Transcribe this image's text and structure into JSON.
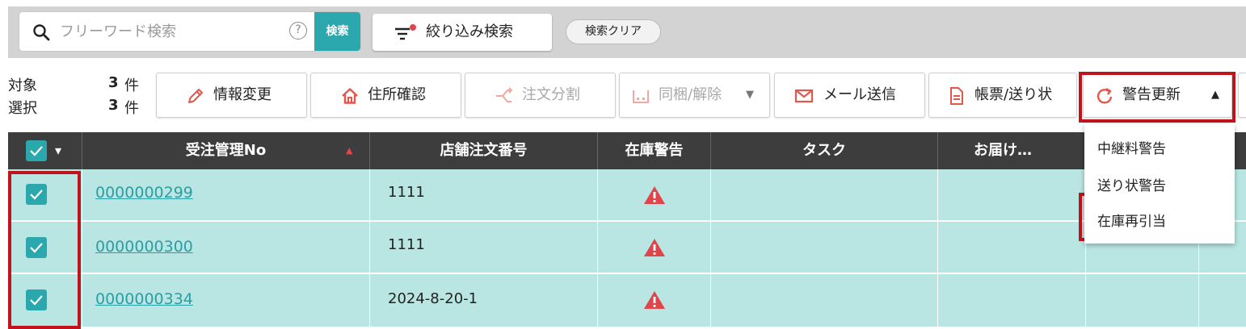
{
  "search": {
    "placeholder": "フリーワード検索",
    "help_label": "?",
    "button_label": "検索",
    "filter_label": "絞り込み検索",
    "clear_label": "検索クリア"
  },
  "counts": {
    "target_label": "対象",
    "target_value": "3",
    "selected_label": "選択",
    "selected_value": "3",
    "unit": "件"
  },
  "toolbar": {
    "buttons": [
      {
        "label": "情報変更",
        "icon": "pencil-icon",
        "enabled": true
      },
      {
        "label": "住所確認",
        "icon": "house-icon",
        "enabled": true
      },
      {
        "label": "注文分割",
        "icon": "split-arrow-icon",
        "enabled": false
      },
      {
        "label": "同梱/解除",
        "icon": "bundle-icon",
        "enabled": false
      },
      {
        "label": "メール送信",
        "icon": "mail-icon",
        "enabled": true
      },
      {
        "label": "帳票/送り状",
        "icon": "document-icon",
        "enabled": true
      },
      {
        "label": "警告更新",
        "icon": "refresh-icon",
        "enabled": true,
        "expanded": true
      }
    ],
    "dropdown_caret": "▼",
    "expanded_caret": "▲"
  },
  "warning_menu": {
    "items": [
      "中継料警告",
      "送り状警告",
      "在庫再引当"
    ],
    "highlighted_item": "在庫再引当"
  },
  "table": {
    "header_caret": "▾",
    "sort_indicator": "▲",
    "columns": [
      "受注管理No",
      "店舗注文番号",
      "在庫警告",
      "タスク",
      "お届け…"
    ],
    "rows": [
      {
        "checked": true,
        "order_no": "0000000299",
        "shop_order_no": "1111",
        "stock_warning": true
      },
      {
        "checked": true,
        "order_no": "0000000300",
        "shop_order_no": "1111",
        "stock_warning": true
      },
      {
        "checked": true,
        "order_no": "0000000334",
        "shop_order_no": "2024-8-20-1",
        "stock_warning": true
      }
    ]
  },
  "colors": {
    "accent": "#2aa8ae",
    "highlight_border": "#c0141c",
    "row_background": "#b9e5e3",
    "header_background": "#3d3d3d",
    "warning": "#e0454b"
  }
}
